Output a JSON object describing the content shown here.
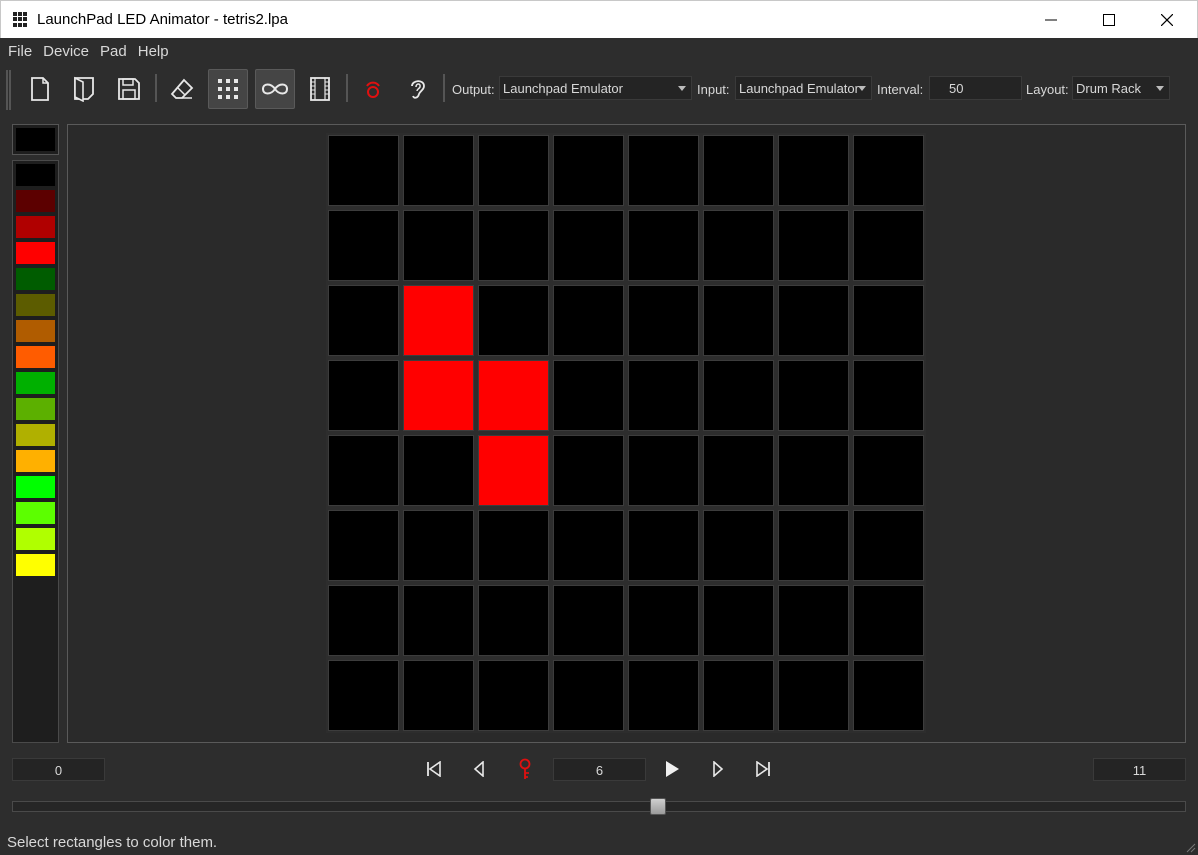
{
  "window": {
    "title": "LaunchPad LED Animator - tetris2.lpa",
    "app_icon": "grid-icon",
    "controls": [
      "minimize-icon",
      "maximize-icon",
      "close-icon"
    ]
  },
  "menu": [
    "File",
    "Device",
    "Pad",
    "Help"
  ],
  "toolbar": {
    "buttons": [
      {
        "name": "new-file",
        "icon": "new-file-icon",
        "active": false
      },
      {
        "name": "open-file",
        "icon": "open-file-icon",
        "active": false
      },
      {
        "name": "save-file",
        "icon": "save-icon",
        "active": false
      },
      {
        "name": "eraser",
        "icon": "eraser-icon",
        "active": false
      },
      {
        "name": "grid-mode",
        "icon": "grid-icon",
        "active": true
      },
      {
        "name": "loop",
        "icon": "infinity-icon",
        "active": true
      },
      {
        "name": "frames",
        "icon": "film-icon",
        "active": false
      },
      {
        "name": "record",
        "icon": "record-icon",
        "active": false
      },
      {
        "name": "listen",
        "icon": "ear-icon",
        "active": false
      }
    ],
    "output_label": "Output:",
    "output_value": "Launchpad Emulator",
    "input_label": "Input:",
    "input_value": "Launchpad Emulator",
    "interval_label": "Interval:",
    "interval_value": "50",
    "layout_label": "Layout:",
    "layout_value": "Drum Rack"
  },
  "palette": {
    "current": "#000000",
    "colors": [
      "#000000",
      "#5c0000",
      "#b00000",
      "#ff0000",
      "#005c00",
      "#5c5c00",
      "#b05c00",
      "#ff5c00",
      "#00b000",
      "#5cb000",
      "#b0b000",
      "#ffb000",
      "#00ff00",
      "#5cff00",
      "#b0ff00",
      "#ffff00"
    ]
  },
  "grid": {
    "rows": 8,
    "cols": 8,
    "lit": [
      {
        "row": 2,
        "col": 1,
        "color": "#ff0000"
      },
      {
        "row": 3,
        "col": 1,
        "color": "#ff0000"
      },
      {
        "row": 3,
        "col": 2,
        "color": "#ff0000"
      },
      {
        "row": 4,
        "col": 2,
        "color": "#ff0000"
      }
    ],
    "off_color": "#000000"
  },
  "transport": {
    "start_frame": "0",
    "current_frame": "6",
    "end_frame": "11",
    "buttons": [
      "skip-to-start-icon",
      "step-back-icon",
      "keyframe-icon",
      "play-icon",
      "step-forward-icon",
      "skip-to-end-icon"
    ]
  },
  "timeline": {
    "position": 0.55
  },
  "status": "Select rectangles to color them."
}
